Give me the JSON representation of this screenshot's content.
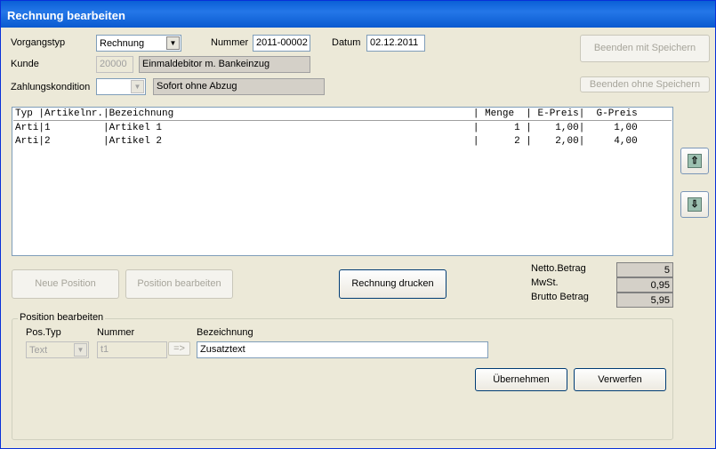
{
  "window": {
    "title": "Rechnung bearbeiten"
  },
  "header": {
    "vorgangstyp_label": "Vorgangstyp",
    "vorgangstyp_value": "Rechnung",
    "nummer_label": "Nummer",
    "nummer_value": "2011-00002",
    "datum_label": "Datum",
    "datum_value": "02.12.2011",
    "kunde_label": "Kunde",
    "kunde_nr": "20000",
    "kunde_name": "Einmaldebitor m. Bankeinzug",
    "zahlung_label": "Zahlungskondition",
    "zahlung_value": "",
    "zahlung_text": "Sofort ohne Abzug"
  },
  "buttons": {
    "beenden_speichern": "Beenden mit Speichern",
    "beenden_ohne": "Beenden ohne Speichern",
    "neue_position": "Neue Position",
    "position_bearbeiten": "Position bearbeiten",
    "rechnung_drucken": "Rechnung drucken",
    "uebernehmen": "Übernehmen",
    "verwerfen": "Verwerfen",
    "arrow_go": "=>"
  },
  "list": {
    "header": "Typ |Artikelnr.|Bezeichnung                                                   | Menge  | E-Preis|  G-Preis",
    "rows": [
      "Arti|1         |Artikel 1                                                     |      1 |    1,00|     1,00",
      "Arti|2         |Artikel 2                                                     |      2 |    2,00|     4,00"
    ]
  },
  "totals": {
    "netto_label": "Netto.Betrag",
    "netto_value": "5",
    "mwst_label": "MwSt.",
    "mwst_value": "0,95",
    "brutto_label": "Brutto Betrag",
    "brutto_value": "5,95"
  },
  "position": {
    "group_title": "Position bearbeiten",
    "postyp_label": "Pos.Typ",
    "postyp_value": "Text",
    "nummer_label": "Nummer",
    "nummer_value": "t1",
    "bezeichnung_label": "Bezeichnung",
    "bezeichnung_value": "Zusatztext"
  },
  "icons": {
    "up": "move-up-icon",
    "down": "move-down-icon"
  }
}
